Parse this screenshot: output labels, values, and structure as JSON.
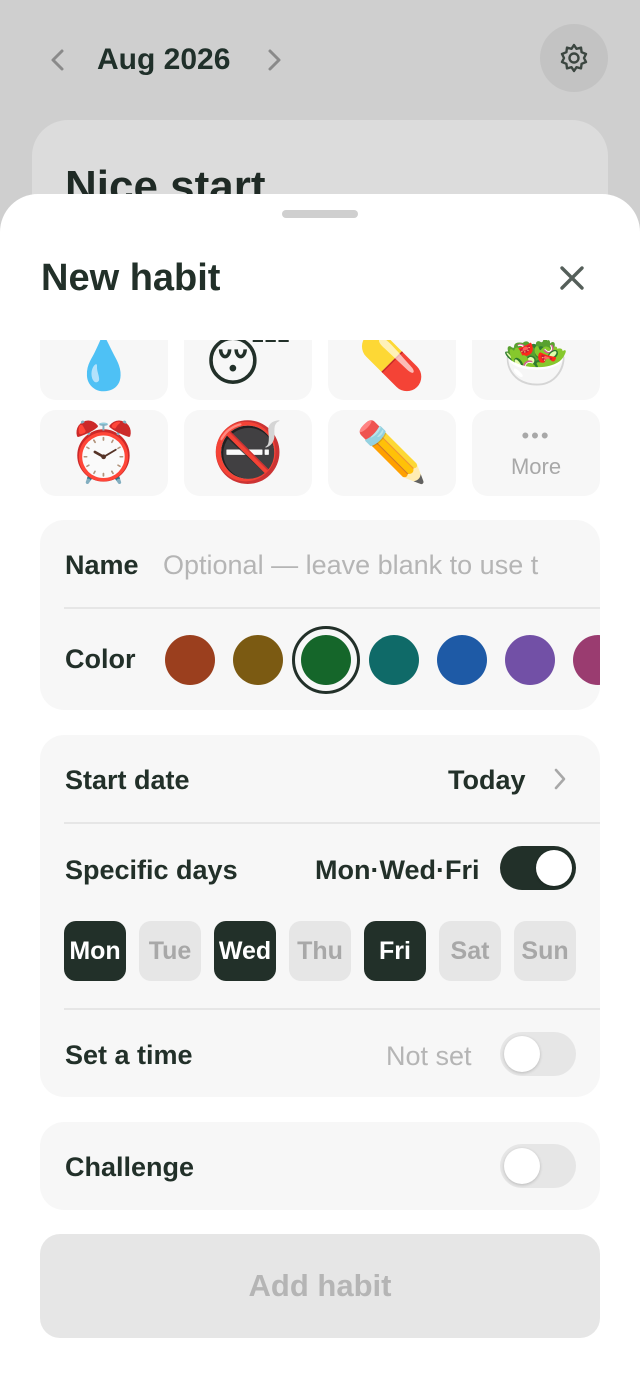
{
  "background": {
    "month_title": "Aug 2026",
    "card_title": "Nice start"
  },
  "sheet": {
    "title": "New habit",
    "icons_row1": [
      "💧",
      "😴",
      "💊",
      "🥗"
    ],
    "icons_row2": [
      "⏰",
      "🚭",
      "✏️"
    ],
    "more_dots": "•••",
    "more_label": "More"
  },
  "name_row": {
    "label": "Name",
    "placeholder": "Optional — leave blank to use t"
  },
  "color_row": {
    "label": "Color",
    "swatches": [
      "#9b3f1e",
      "#7b5a12",
      "#15662a",
      "#0f6a68",
      "#1e5aa6",
      "#7250a6",
      "#9a3c70"
    ],
    "selected_index": 2
  },
  "schedule": {
    "start_date_label": "Start date",
    "start_date_value": "Today",
    "specific_days_label": "Specific days",
    "specific_days_value": "Mon·Wed·Fri",
    "specific_days_on": true,
    "days": [
      {
        "label": "Mon",
        "selected": true
      },
      {
        "label": "Tue",
        "selected": false
      },
      {
        "label": "Wed",
        "selected": true
      },
      {
        "label": "Thu",
        "selected": false
      },
      {
        "label": "Fri",
        "selected": true
      },
      {
        "label": "Sat",
        "selected": false
      },
      {
        "label": "Sun",
        "selected": false
      }
    ],
    "time_label": "Set a time",
    "time_value": "Not set",
    "time_on": false
  },
  "challenge": {
    "label": "Challenge",
    "on": false
  },
  "add_button": "Add habit",
  "colors": {
    "primary_dark": "#223029",
    "muted_text": "#b5b5b5",
    "card_bg": "#f7f7f7"
  }
}
